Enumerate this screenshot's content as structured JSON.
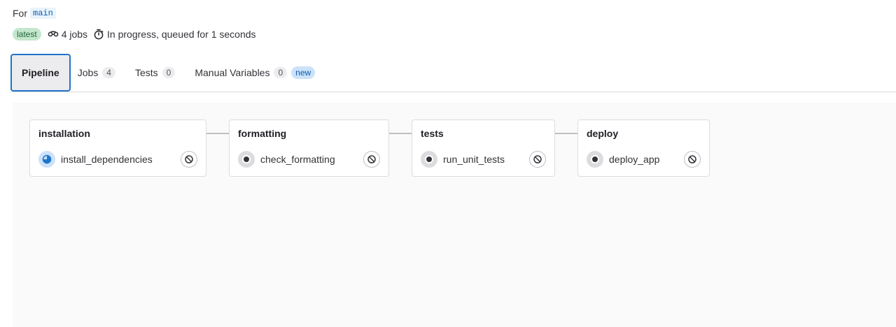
{
  "header": {
    "for_label": "For",
    "branch": "main",
    "latest_badge": "latest",
    "jobs_count_text": "4 jobs",
    "status_text": "In progress, queued for 1 seconds"
  },
  "tabs": [
    {
      "label": "Pipeline",
      "active": true
    },
    {
      "label": "Jobs",
      "count": "4"
    },
    {
      "label": "Tests",
      "count": "0"
    },
    {
      "label": "Manual Variables",
      "count": "0",
      "badge": "new"
    }
  ],
  "stages": [
    {
      "title": "installation",
      "job": "install_dependencies",
      "status": "running"
    },
    {
      "title": "formatting",
      "job": "check_formatting",
      "status": "created"
    },
    {
      "title": "tests",
      "job": "run_unit_tests",
      "status": "created"
    },
    {
      "title": "deploy",
      "job": "deploy_app",
      "status": "created"
    }
  ],
  "icons": {
    "jobs": "pipeline-jobs-icon",
    "timer": "timer-icon",
    "cancel": "cancel-icon",
    "running": "status-running-icon",
    "created": "status-created-icon"
  },
  "colors": {
    "accent": "#1f75cb",
    "running": "#1f75cb",
    "created": "#333238",
    "latest_bg": "#c3e6cd"
  }
}
